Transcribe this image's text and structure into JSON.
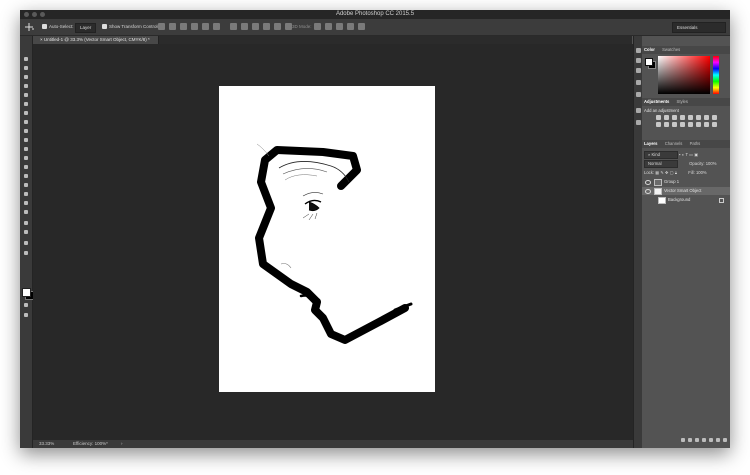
{
  "app_title": "Adobe Photoshop CC 2015.5",
  "options_bar": {
    "auto_select_label": "Auto-Select:",
    "auto_select_value": "Layer",
    "transform_label": "Show Transform Controls",
    "mode_3d_label": "3D Mode:",
    "workspace": "Essentials"
  },
  "document": {
    "tab_title": "Untitled-1 @ 33.3% (Vector Smart Object, CMYK/8) *"
  },
  "status_bar": {
    "zoom": "33.33%",
    "efficiency": "Efficiency: 100%*"
  },
  "panels": {
    "color": {
      "tabs": [
        "Color",
        "Swatches"
      ]
    },
    "adjustments": {
      "tabs": [
        "Adjustments",
        "Styles"
      ],
      "add_label": "Add an adjustment"
    },
    "layers": {
      "tabs": [
        "Layers",
        "Channels",
        "Paths"
      ],
      "filter_kind": "Kind",
      "blend_mode": "Normal",
      "opacity_label": "Opacity:",
      "opacity_value": "100%",
      "lock_label": "Lock:",
      "fill_label": "Fill:",
      "fill_value": "100%",
      "items": [
        {
          "name": "Group 1"
        },
        {
          "name": "Vector Smart Object"
        },
        {
          "name": "Background"
        }
      ]
    }
  },
  "colors": {
    "foreground": "#ffffff",
    "background": "#000000",
    "window": "#535353",
    "canvas_bg": "#282828"
  }
}
